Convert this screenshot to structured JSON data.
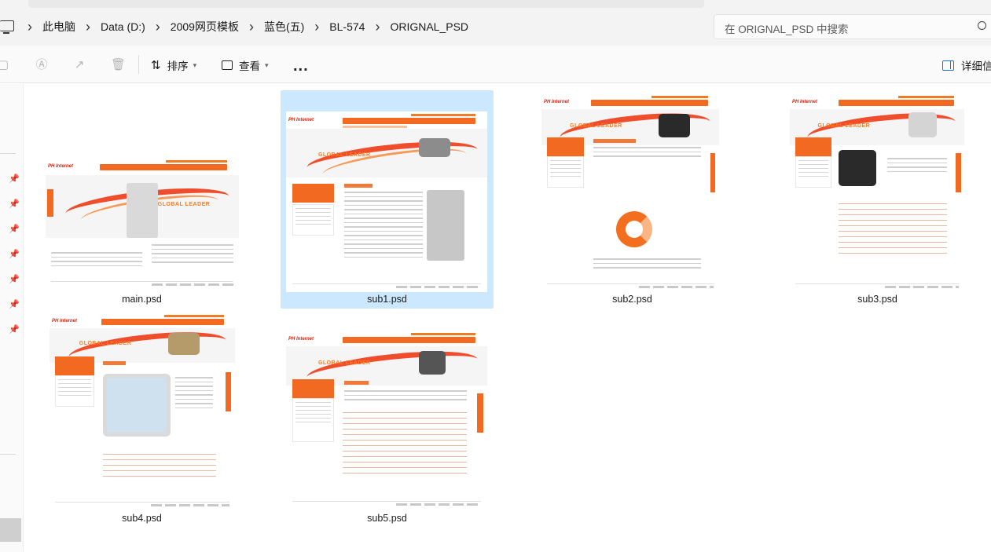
{
  "window": {
    "breadcrumbs": [
      "此电脑",
      "Data (D:)",
      "2009网页模板",
      "蓝色(五)",
      "BL-574",
      "ORIGNAL_PSD"
    ],
    "search_placeholder": "在 ORIGNAL_PSD 中搜索"
  },
  "toolbar": {
    "sort_label": "排序",
    "view_label": "查看",
    "more_label": "...",
    "details_label": "详细信息"
  },
  "icons": {
    "pc": "computer-icon",
    "cut": "cut-icon",
    "rename": "rename-icon",
    "share": "share-icon",
    "delete": "delete-icon",
    "sort": "sort-icon",
    "view": "view-icon",
    "details": "details-pane-icon",
    "pin": "pin-icon"
  },
  "colors": {
    "selection": "#cce8ff",
    "accent_orange": "#f26a21",
    "accent_red": "#ef3b16"
  },
  "thumbnail_text": {
    "logo": "PH Internet",
    "headline": "GLOBAL LEADER"
  },
  "files": [
    {
      "name": "main.psd",
      "selected": false
    },
    {
      "name": "sub1.psd",
      "selected": true
    },
    {
      "name": "sub2.psd",
      "selected": false
    },
    {
      "name": "sub3.psd",
      "selected": false
    },
    {
      "name": "sub4.psd",
      "selected": false
    },
    {
      "name": "sub5.psd",
      "selected": false
    }
  ]
}
